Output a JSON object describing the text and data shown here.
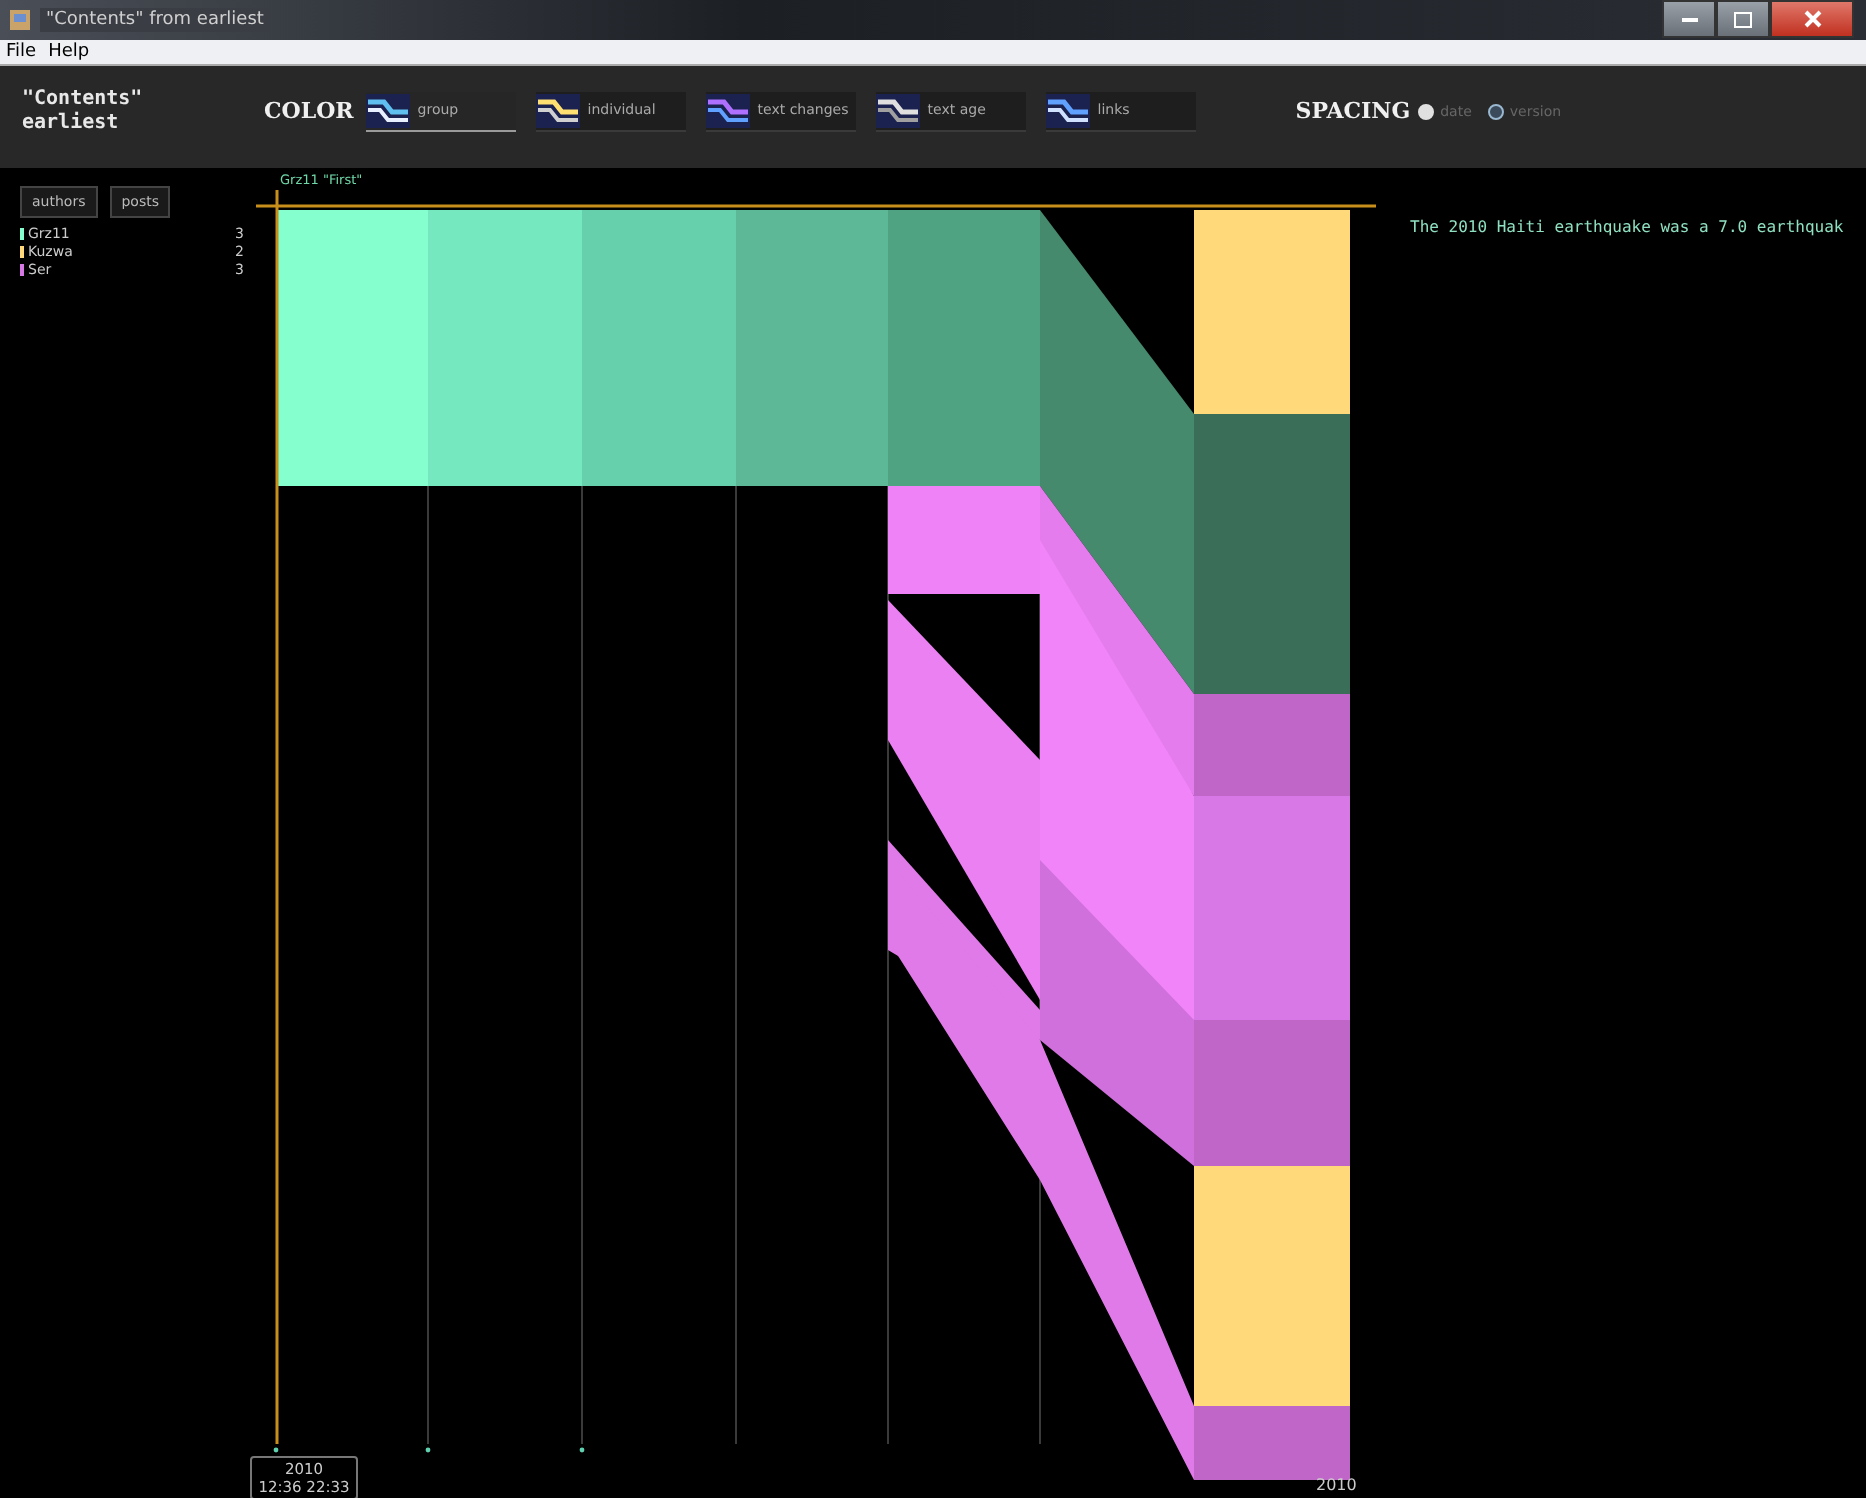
{
  "window": {
    "title": "\"Contents\" from earliest"
  },
  "menu": [
    "File",
    "Help"
  ],
  "header": {
    "title": [
      "\"Contents\"",
      "earliest"
    ]
  },
  "color": {
    "label": "COLOR",
    "modes": [
      {
        "label": "group",
        "selected": true
      },
      {
        "label": "individual",
        "selected": false
      },
      {
        "label": "text changes",
        "selected": false
      },
      {
        "label": "text age",
        "selected": false
      },
      {
        "label": "links",
        "selected": false
      }
    ]
  },
  "spacing": {
    "label": "SPACING",
    "options": [
      {
        "label": "date",
        "selected": true
      },
      {
        "label": "version",
        "selected": false
      }
    ]
  },
  "sidebar": {
    "buttons": [
      "authors",
      "posts"
    ],
    "authors": [
      {
        "name": "Grz11",
        "count": "3",
        "color": "#86ffcf"
      },
      {
        "name": "Kuzwa",
        "count": "2",
        "color": "#ffd97a"
      },
      {
        "name": "Ser",
        "count": "3",
        "color": "#d877e6"
      }
    ]
  },
  "chart": {
    "version_label": "Grz11 \"First\"",
    "start_label": [
      "2010",
      "12:36 22:33"
    ],
    "end_label": "2010"
  },
  "text_preview": "The 2010 Haiti earthquake was a 7.0 earthquak"
}
